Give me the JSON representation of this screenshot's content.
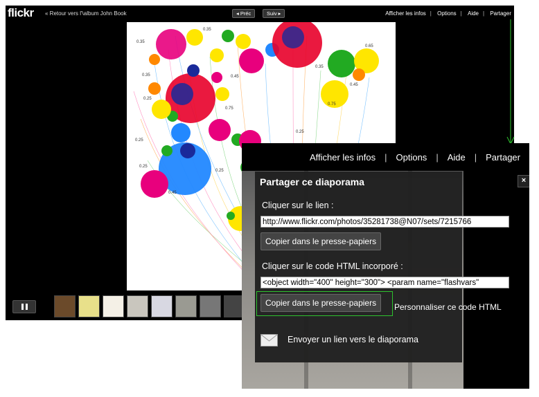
{
  "colors": {
    "background": "#000000",
    "accent_green": "#2ec42e",
    "dialog_bg": "#202020",
    "button_bg": "#444444"
  },
  "slideshow": {
    "logo_text": "flickr",
    "back_link": "« Retour vers l'\\album John Book",
    "prev_label": "◂ Préc",
    "next_label": "Suiv ▸",
    "top_links": [
      "Afficher les infos",
      "Options",
      "Aide",
      "Partager"
    ],
    "pause_icon": "pause-icon",
    "thumbnails": 9
  },
  "share_panel": {
    "top_links": [
      "Afficher les infos",
      "Options",
      "Aide",
      "Partager"
    ],
    "title": "Partager ce diaporama",
    "close_icon": "close-icon",
    "close_glyph": "×",
    "link_label": "Cliquer sur le lien :",
    "link_value": "http://www.flickr.com/photos/35281738@N07/sets/7215766",
    "copy_label": "Copier dans le presse-papiers",
    "embed_label": "Cliquer sur le code HTML incorporé :",
    "embed_value": "<object width=\"400\" height=\"300\"> <param name=\"flashvars\"",
    "customize_label": "Personnaliser ce code HTML",
    "email_label": "Envoyer un lien vers le diaporama",
    "email_icon": "envelope-icon"
  }
}
